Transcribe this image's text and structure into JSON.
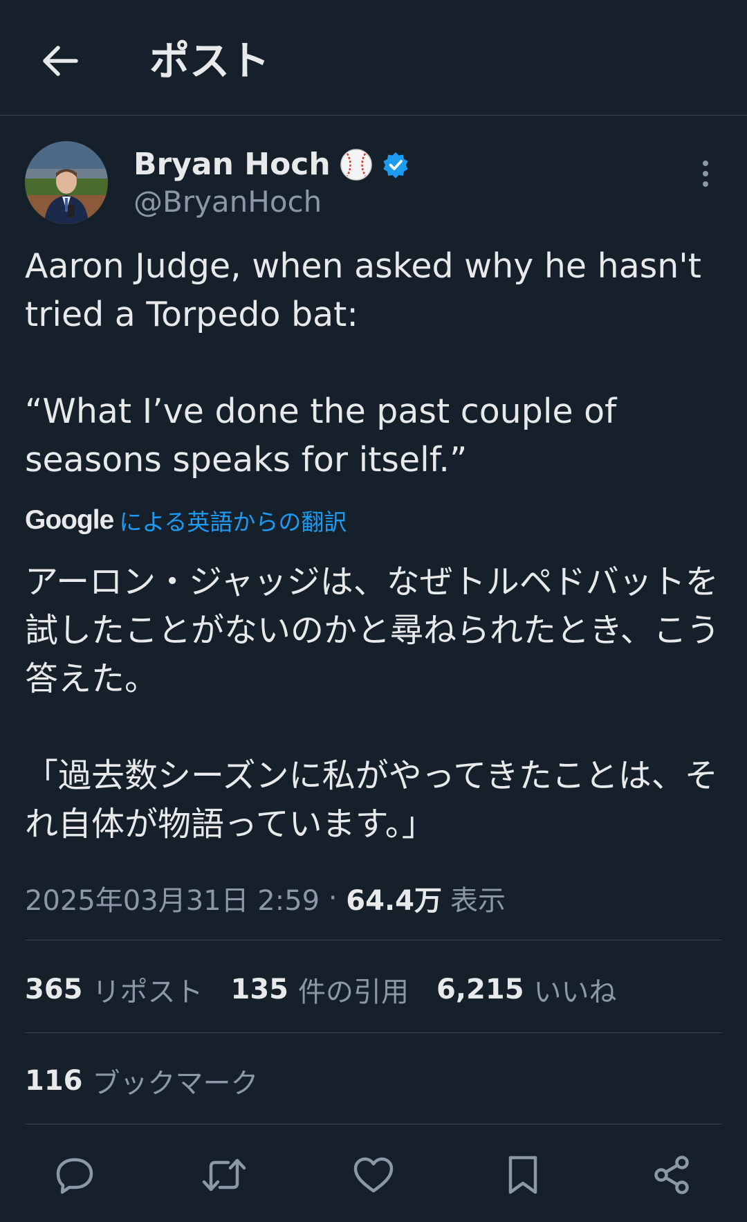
{
  "header": {
    "title": "ポスト"
  },
  "author": {
    "name": "Bryan Hoch",
    "handle": "@BryanHoch"
  },
  "tweet": {
    "text": "Aaron Judge, when asked why he hasn't tried a Torpedo bat:\n\n“What I’ve done the past couple of seasons speaks for itself.”",
    "translation_brand": "Google",
    "translation_label": "による英語からの翻訳",
    "translated_text": "アーロン・ジャッジは、なぜトルペドバットを試したことがないのかと尋ねられたとき、こう答えた。\n\n「過去数シーズンに私がやってきたことは、それ自体が物語っています。」"
  },
  "meta": {
    "timestamp": "2025年03月31日 2:59",
    "separator": " · ",
    "views_count": "64.4万",
    "views_label": "表示"
  },
  "stats": {
    "reposts_count": "365",
    "reposts_label": "リポスト",
    "quotes_count": "135",
    "quotes_label": "件の引用",
    "likes_count": "6,215",
    "likes_label": "いいね",
    "bookmarks_count": "116",
    "bookmarks_label": "ブックマーク"
  },
  "icons": {
    "back": "arrow-left-icon",
    "emoji": "baseball-icon",
    "verified": "verified-badge-icon",
    "more": "more-vertical-icon",
    "reply": "reply-icon",
    "repost": "repost-icon",
    "like": "heart-icon",
    "bookmark": "bookmark-icon",
    "share": "share-icon"
  },
  "colors": {
    "background": "#15202b",
    "text_primary": "#e7e9ea",
    "text_secondary": "#8b98a5",
    "accent": "#1d9bf0",
    "divider": "#38444d"
  }
}
